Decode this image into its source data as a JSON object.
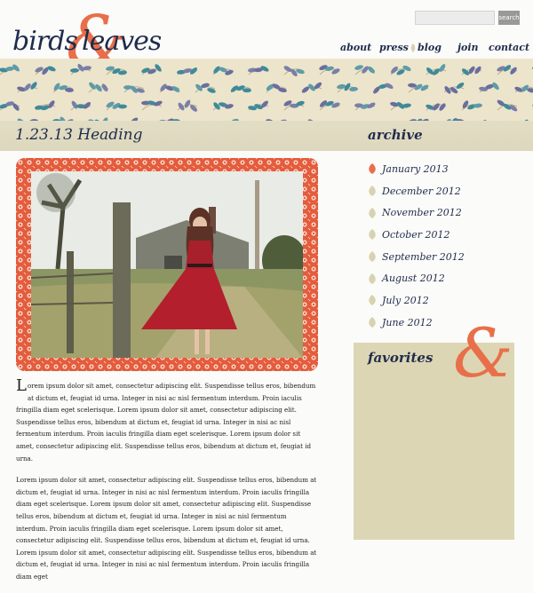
{
  "brand": {
    "word1": "birds",
    "ampersand": "&",
    "word2": "leaves"
  },
  "search": {
    "placeholder": "",
    "button_label": "search"
  },
  "nav": [
    {
      "label": "about"
    },
    {
      "label": "press"
    },
    {
      "label": "blog"
    },
    {
      "label": "join"
    },
    {
      "label": "contact"
    }
  ],
  "post": {
    "title": "1.23.13 Heading",
    "dropcap": "L",
    "para1_lead": "orem ipsum dolor sit amet, consectetur adipiscing elit. Suspendisse tellus eros, bibendum at dictum et, feugiat id urna. Integer in nisi ac nisl fermentum interdum. Proin iaculis fringilla diam eget scelerisque. Lorem ipsum dolor sit amet, consectetur adipiscing elit. Suspendisse tellus eros, bibendum at dictum et, feugiat id urna. Integer in nisi ac nisl fermentum interdum. Proin iaculis fringilla diam eget scelerisque. Lorem ipsum dolor sit amet, consectetur adipiscing elit. Suspendisse tellus eros, bibendum at dictum et, feugiat id urna.",
    "para2": "Lorem ipsum dolor sit amet, consectetur adipiscing elit. Suspendisse tellus eros, bibendum at dictum et, feugiat id urna. Integer in nisi ac nisl fermentum interdum. Proin iaculis fringilla diam eget scelerisque. Lorem ipsum dolor sit amet, consectetur adipiscing elit. Suspendisse tellus eros, bibendum at dictum et, feugiat id urna. Integer in nisi ac nisl fermentum interdum. Proin iaculis fringilla diam eget scelerisque. Lorem ipsum dolor sit amet, consectetur adipiscing elit. Suspendisse tellus eros, bibendum at dictum et, feugiat id urna. Lorem ipsum dolor sit amet, consectetur adipiscing elit. Suspendisse tellus eros, bibendum at dictum et, feugiat id urna. Integer in nisi ac nisl fermentum interdum. Proin iaculis fringilla diam eget"
  },
  "archive": {
    "title": "archive",
    "items": [
      {
        "label": "January 2013",
        "active": true
      },
      {
        "label": "December 2012",
        "active": false
      },
      {
        "label": "November 2012",
        "active": false
      },
      {
        "label": "October 2012",
        "active": false
      },
      {
        "label": "September 2012",
        "active": false
      },
      {
        "label": "August 2012",
        "active": false
      },
      {
        "label": "July 2012",
        "active": false
      },
      {
        "label": "June 2012",
        "active": false
      }
    ]
  },
  "favorites": {
    "title": "favorites",
    "ampersand": "&"
  },
  "colors": {
    "navy": "#1f2c4c",
    "coral": "#e86f4a",
    "cream": "#ece5cc",
    "khaki": "#dcd6b4",
    "leaf_inactive": "#d8d2b0"
  }
}
